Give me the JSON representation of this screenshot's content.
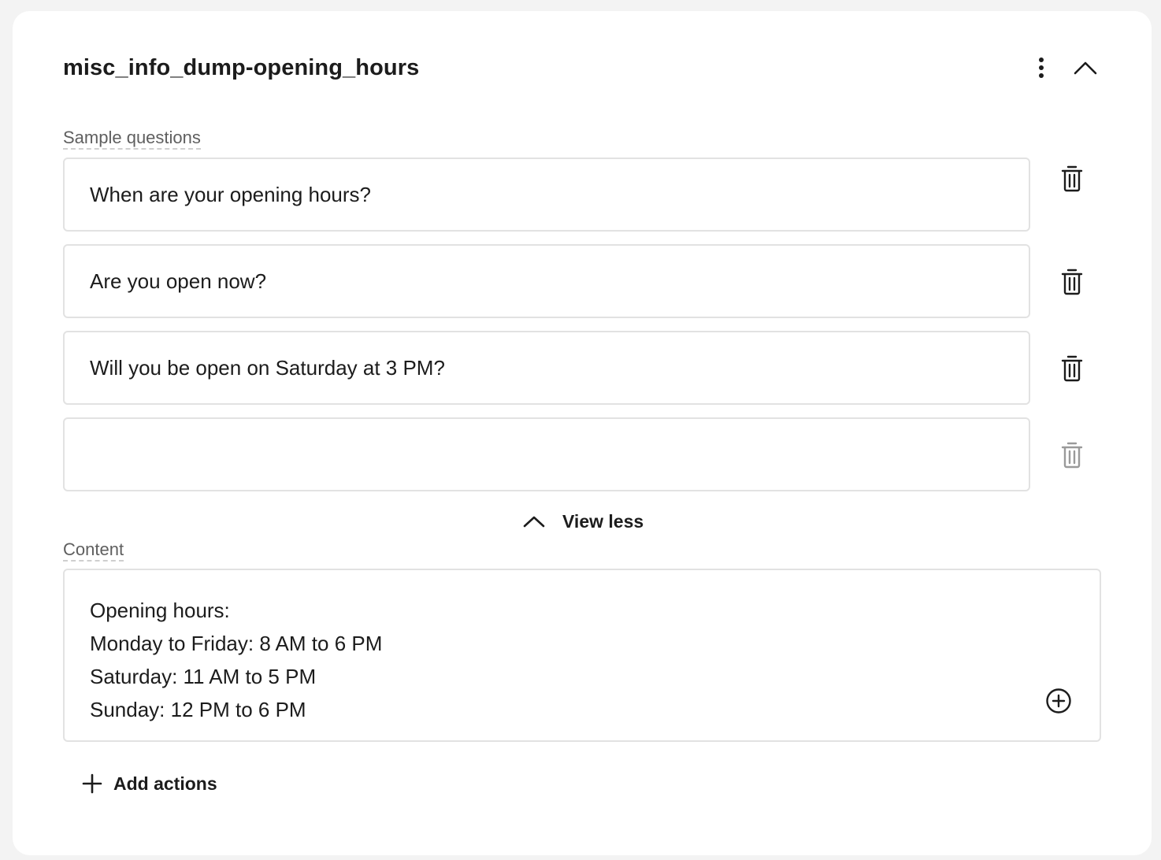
{
  "card": {
    "title": "misc_info_dump-opening_hours",
    "menu_icon": "more-vertical-icon",
    "collapse_icon": "chevron-up-icon"
  },
  "sample_questions": {
    "label": "Sample questions",
    "items": [
      "When are your opening hours?",
      "Are you open now?",
      "Will you be open on Saturday at 3 PM?",
      ""
    ],
    "delete_icon": "trash-icon",
    "view_less_label": "View less"
  },
  "content": {
    "label": "Content",
    "lines": [
      "Opening hours:",
      "Monday to Friday: 8 AM to 6 PM",
      "Saturday: 11 AM to 5 PM",
      "Sunday: 12 PM to 6 PM"
    ],
    "insert_icon": "plus-circle-icon"
  },
  "actions": {
    "add_label": "Add actions",
    "add_icon": "plus-icon"
  },
  "colors": {
    "background": "#f3f3f3",
    "card": "#ffffff",
    "border": "#e2e2e2",
    "text": "#1c1c1c",
    "muted_label": "#5f5f5f",
    "disabled_icon": "#9a9a9a"
  }
}
